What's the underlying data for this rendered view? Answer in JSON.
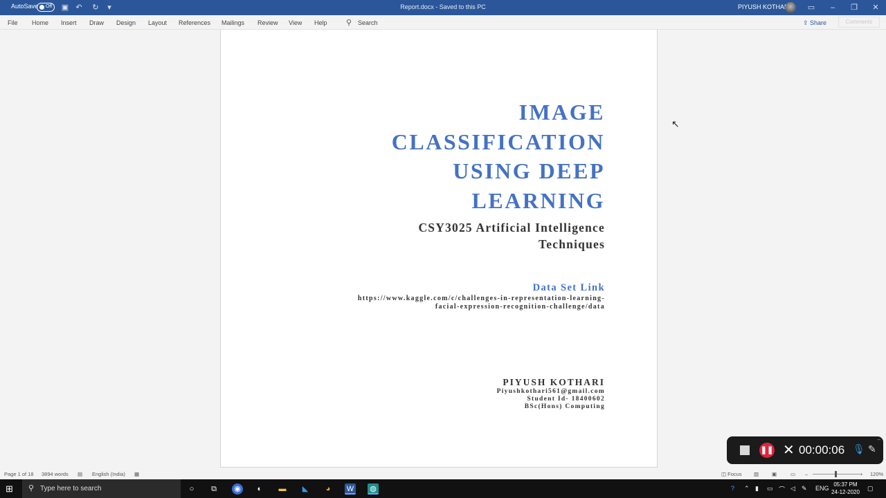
{
  "titlebar": {
    "autosave_label": "AutoSave",
    "autosave_state": "Off",
    "doc_title": "Report.docx  -  Saved to this PC",
    "user_name": "PIYUSH KOTHARI"
  },
  "ribbon": {
    "tabs": [
      "File",
      "Home",
      "Insert",
      "Draw",
      "Design",
      "Layout",
      "References",
      "Mailings",
      "Review",
      "View",
      "Help"
    ],
    "search": "Search",
    "share": "Share",
    "comments": "Comments"
  },
  "document": {
    "title_lines": [
      "IMAGE",
      "CLASSIFICATION",
      "USING DEEP",
      "LEARNING"
    ],
    "subtitle_lines": [
      "CSY3025 Artificial Intelligence",
      "Techniques"
    ],
    "dataset_heading": "Data Set Link",
    "dataset_url_lines": [
      "https://www.kaggle.com/c/challenges-in-representation-learning-",
      "facial-expression-recognition-challenge/data"
    ],
    "author_name": "PIYUSH KOTHARI",
    "author_email": "Piyushkothari561@gmail.com",
    "student_id": "Student Id- 18400602",
    "course": "BSc(Hons) Computing"
  },
  "recorder": {
    "time": "00:00:06"
  },
  "statusbar": {
    "page": "Page 1 of 18",
    "words": "3894 words",
    "language": "English (India)",
    "focus": "Focus",
    "zoom": "120%"
  },
  "taskbar": {
    "search_placeholder": "Type here to search",
    "lang": "ENG",
    "time": "05:37 PM",
    "date": "24-12-2020"
  },
  "colors": {
    "titlebar": "#2b579a",
    "heading": "#4472c4",
    "recorder_pause": "#e0243a"
  }
}
